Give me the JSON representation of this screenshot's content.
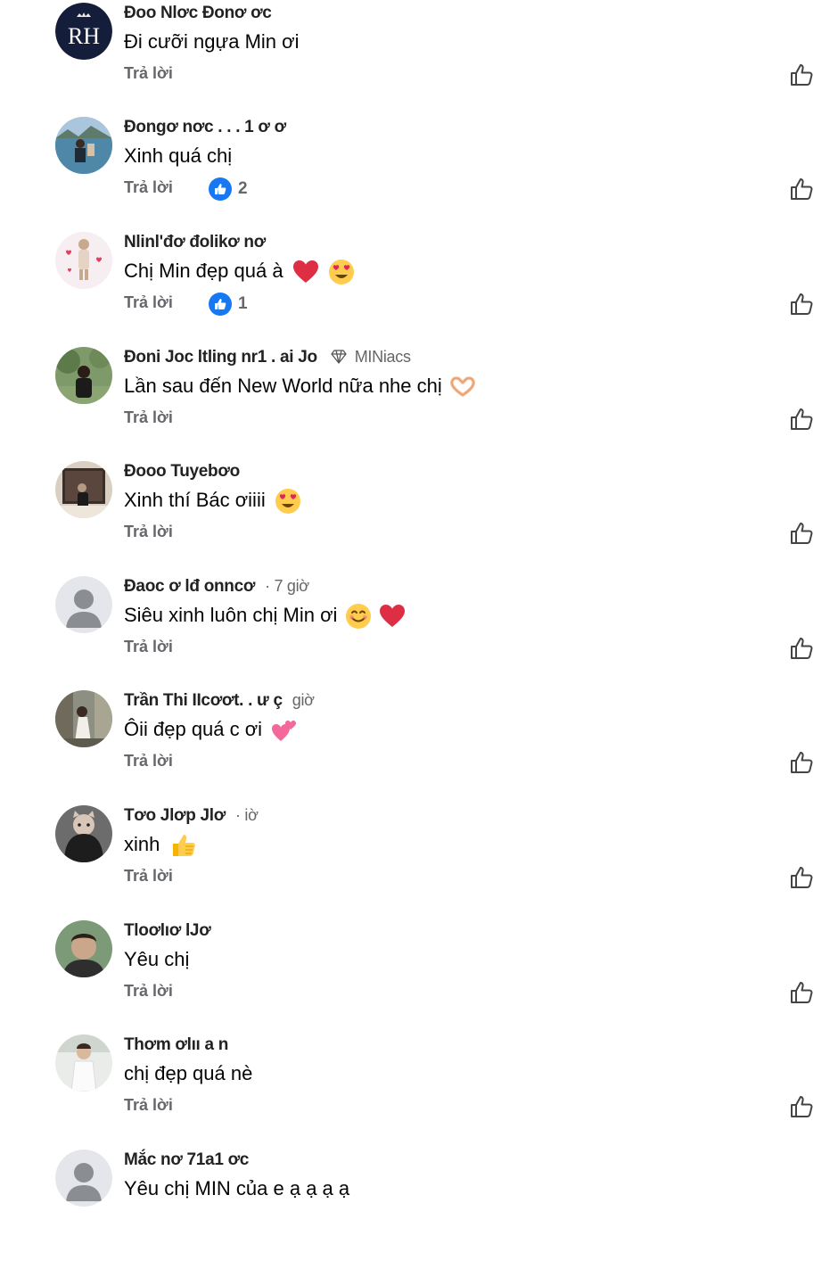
{
  "reply_label": "Trả lời",
  "comments": [
    {
      "name": "Đoo Nlơc Đonơ ơc",
      "text": "Đi cưỡi ngựa Min ơi",
      "reactions": null,
      "avatar": "logo-rh",
      "avatar_logo_text": "RH"
    },
    {
      "name": "Đongơ nơc   . . .   1 ơ ơ",
      "text": "Xinh quá chị",
      "reactions": "2",
      "avatar": "photo-lake"
    },
    {
      "name": "Nlinl'đơ đolikơ nơ",
      "text": "Chị Min đẹp quá à",
      "reactions": "1",
      "avatar": "photo-cartoon-hearts"
    },
    {
      "name": "Đoni Joc ltling nr1 . ai Jo",
      "badge": "MINiacs",
      "text": "Lần sau đến New World nữa nhe chị",
      "reactions": null,
      "avatar": "photo-park"
    },
    {
      "name": "Đooo Tuyebơo",
      "text": "Xinh thí Bác ơiiii",
      "reactions": null,
      "avatar": "photo-room"
    },
    {
      "name": "Đaoc ơ lđ onncơ",
      "time": "· 7 giờ",
      "text": "Siêu xinh luôn chị Min ơi",
      "reactions": null,
      "avatar": "default-user"
    },
    {
      "name": "Trần Thi IIcơơt. . ư ç",
      "time": "giờ",
      "text": "Ôii đẹp quá c ơi",
      "reactions": null,
      "avatar": "photo-street"
    },
    {
      "name": "Tơo Jlơp Jlơ",
      "time": "· iờ",
      "text": "xinh",
      "reactions": null,
      "avatar": "photo-cat"
    },
    {
      "name": "Tloơlıơ lJơ",
      "text": "Yêu chị",
      "reactions": null,
      "avatar": "photo-man"
    },
    {
      "name": "Thơm ơlıı a n",
      "text": "chị đẹp quá nè",
      "reactions": null,
      "avatar": "photo-white"
    },
    {
      "name": "Mắc nơ 71a1 ơc",
      "text": "Yêu chị MIN của e ạ ạ ạ ạ",
      "reactions": null,
      "avatar": "default-user"
    }
  ],
  "icons": {
    "like_outline": "thumbs-up-outline-icon",
    "reaction_like": "like-reaction-icon",
    "badge": "diamond-icon"
  },
  "colors": {
    "reaction_blue": "#1877f2",
    "secondary_text": "#65676b",
    "heart_red": "#e0245e",
    "emoji_yellow": "#ffcc4d"
  }
}
